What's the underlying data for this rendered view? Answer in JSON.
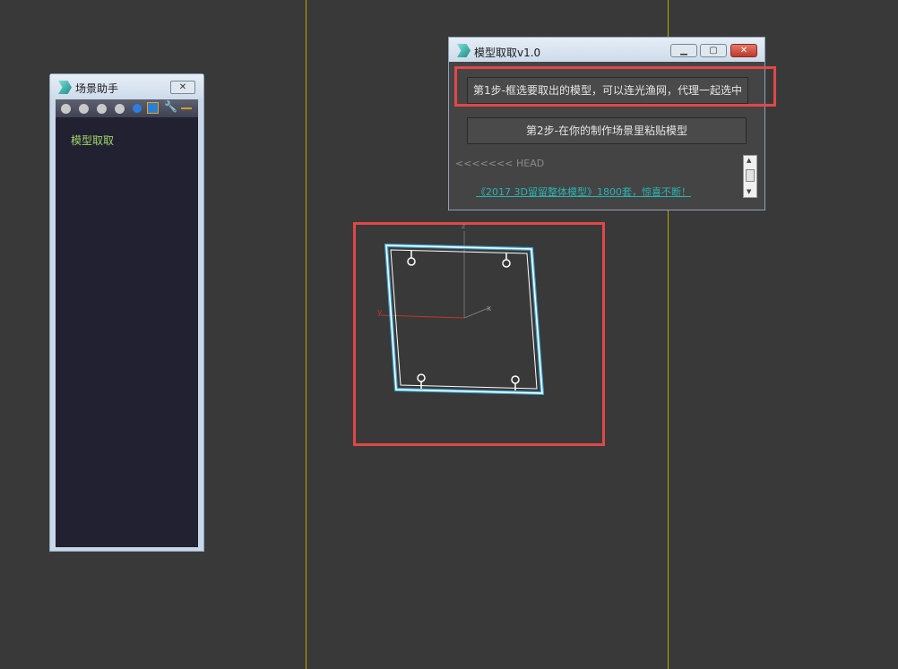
{
  "scene_panel": {
    "title": "场景助手",
    "close_icon": "close-icon",
    "items": [
      {
        "label": "模型取取"
      }
    ]
  },
  "dialog": {
    "title": "模型取取v1.0",
    "step1_label": "第1步-框选要取出的模型，可以连光渔网，代理一起选中",
    "step2_label": "第2步-在你的制作场景里粘贴模型",
    "log_line": "<<<<<<< HEAD",
    "link_text": "《2017 3D留留整体模型》1800套，惊喜不断！"
  },
  "viewport": {
    "axis_y": "y",
    "axis_x": "x",
    "axis_z": "z"
  },
  "colors": {
    "background": "#393939",
    "highlight": "#e04848",
    "selection": "#3aa6d8",
    "link": "#2bb3b0",
    "panel_text": "#9fd46a"
  }
}
